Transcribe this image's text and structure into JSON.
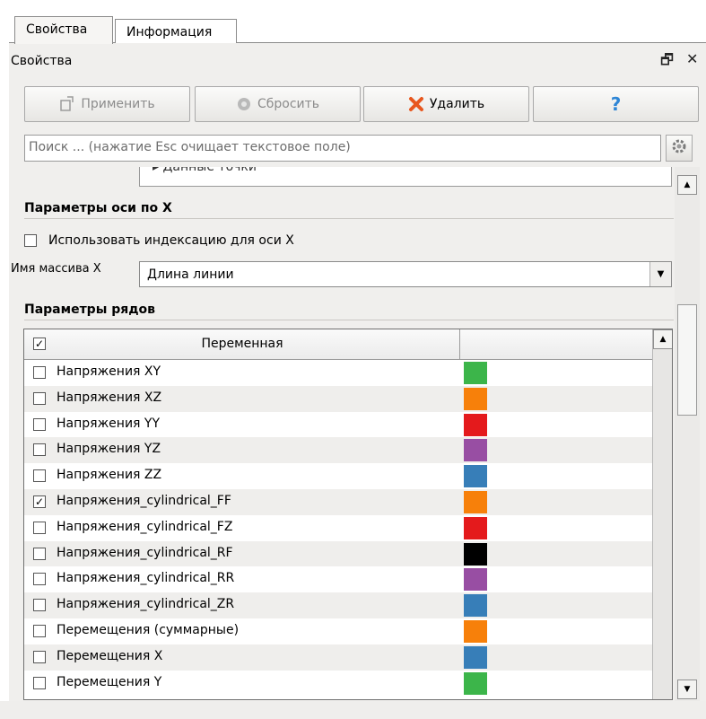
{
  "tabs": [
    {
      "label": "Свойства",
      "active": true
    },
    {
      "label": "Информация",
      "active": false
    }
  ],
  "panel": {
    "title": "Свойства",
    "float_glyph": "🗗",
    "close_glyph": "✕"
  },
  "toolbar": {
    "apply_label": "Применить",
    "reset_label": "Сбросить",
    "delete_label": "Удалить",
    "help_glyph": "?"
  },
  "search": {
    "placeholder": "Поиск ... (нажатие Esc очищает текстовое поле)"
  },
  "cut_off_item": "▸ Данные точки",
  "x_axis": {
    "section_title": "Параметры оси по X",
    "use_index_label": "Использовать индексацию для оси X",
    "use_index_checked": false,
    "array_label": "Имя масcива X",
    "array_value": "Длина линии"
  },
  "series": {
    "section_title": "Параметры рядов",
    "column_variable": "Переменная",
    "column_color": "",
    "header_checked": true,
    "rows": [
      {
        "name": "Напряжения XY",
        "checked": false,
        "color": "#3cb54a"
      },
      {
        "name": "Напряжения XZ",
        "checked": false,
        "color": "#f7800a"
      },
      {
        "name": "Напряжения YY",
        "checked": false,
        "color": "#e41a1c"
      },
      {
        "name": "Напряжения YZ",
        "checked": false,
        "color": "#984ea3"
      },
      {
        "name": "Напряжения ZZ",
        "checked": false,
        "color": "#377eb8"
      },
      {
        "name": "Напряжения_cylindrical_FF",
        "checked": true,
        "color": "#f7800a"
      },
      {
        "name": "Напряжения_cylindrical_FZ",
        "checked": false,
        "color": "#e41a1c"
      },
      {
        "name": "Напряжения_cylindrical_RF",
        "checked": false,
        "color": "#000000"
      },
      {
        "name": "Напряжения_cylindrical_RR",
        "checked": false,
        "color": "#984ea3"
      },
      {
        "name": "Напряжения_cylindrical_ZR",
        "checked": false,
        "color": "#377eb8"
      },
      {
        "name": "Перемещения (суммарные)",
        "checked": false,
        "color": "#f7800a"
      },
      {
        "name": "Перемещения X",
        "checked": false,
        "color": "#377eb8"
      },
      {
        "name": "Перемещения Y",
        "checked": false,
        "color": "#3cb54a"
      }
    ]
  },
  "icons": {
    "check": "✓",
    "up_arrow": "▲",
    "down_arrow": "▼"
  }
}
